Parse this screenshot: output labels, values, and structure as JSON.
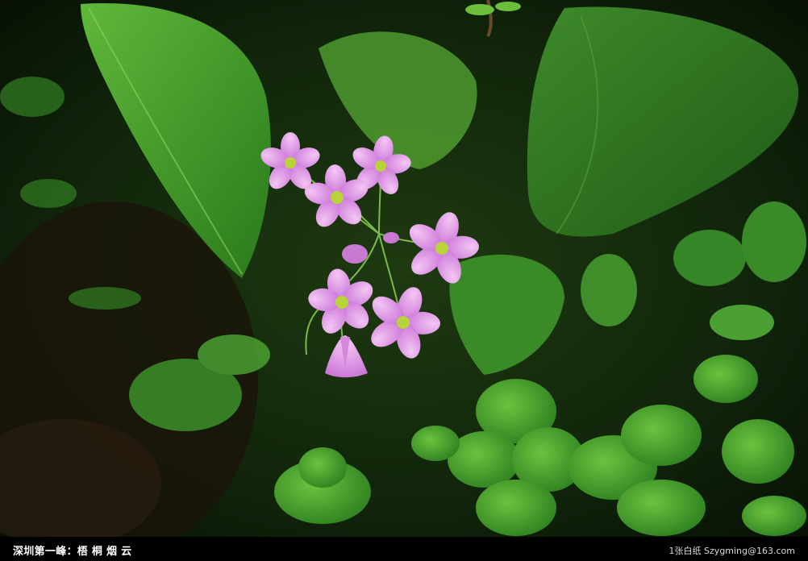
{
  "caption": {
    "title": "深圳第一峰：梧 桐 烟 云",
    "credit": "1张白纸 Szygming@163.com"
  },
  "colors": {
    "caption_background": "#000000",
    "caption_text": "#ffffff",
    "flower_petal": "#e39ae8",
    "flower_center": "#b9d43a",
    "leaf_green": "#3f9a2c"
  }
}
